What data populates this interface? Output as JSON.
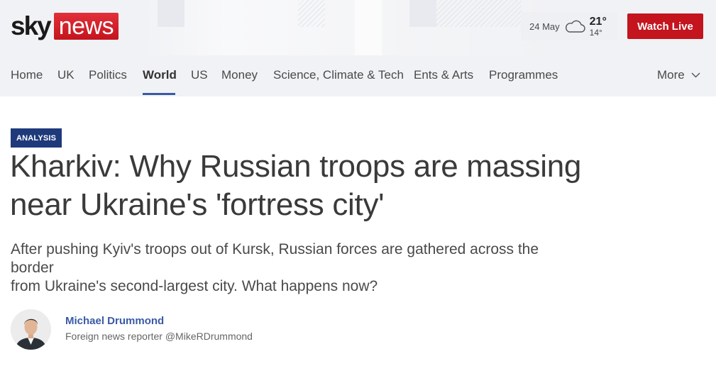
{
  "brand": {
    "logo_sky": "sky",
    "logo_news": "news",
    "accent_color": "#c4141d",
    "link_color": "#3b5aa5",
    "badge_color": "#1e3a7b"
  },
  "weather": {
    "date": "24 May",
    "icon": "cloud-icon",
    "high": "21°",
    "low": "14°"
  },
  "watch_live_label": "Watch Live",
  "nav": {
    "items": [
      {
        "label": "Home"
      },
      {
        "label": "UK"
      },
      {
        "label": "Politics"
      },
      {
        "label": "World",
        "active": true
      },
      {
        "label": "US"
      },
      {
        "label": "Money"
      },
      {
        "label": "Science, Climate & Tech"
      },
      {
        "label": "Ents & Arts"
      },
      {
        "label": "Programmes"
      }
    ],
    "more_label": "More"
  },
  "article": {
    "badge": "ANALYSIS",
    "headline_line1": "Kharkiv: Why Russian troops are massing",
    "headline_line2": "near Ukraine's 'fortress city'",
    "standfirst_line1": "After pushing Kyiv's troops out of Kursk, Russian forces are gathered across the border",
    "standfirst_line2": "from Ukraine's second-largest city. What happens now?"
  },
  "author": {
    "name": "Michael Drummond",
    "role": "Foreign news reporter",
    "handle": "@MikeRDrummond"
  }
}
